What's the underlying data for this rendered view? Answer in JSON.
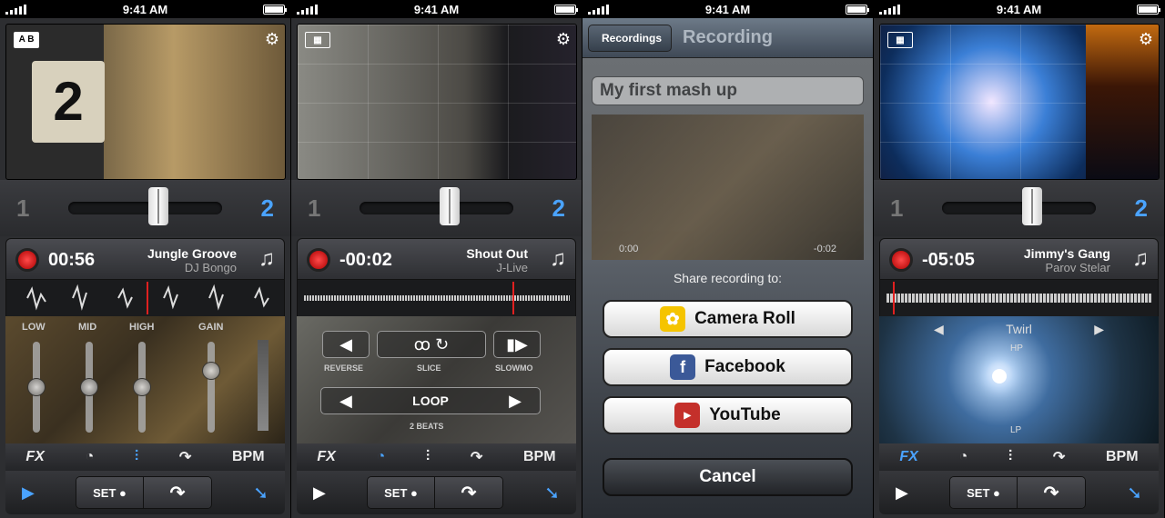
{
  "status": {
    "time": "9:41 AM"
  },
  "colors": {
    "accent": "#4aa3ff",
    "record": "#e02020"
  },
  "icons": [
    "gear-icon",
    "ab-icon",
    "grid-icon",
    "music-library-icon",
    "fx-icon",
    "loop-icon",
    "eq-icon",
    "redo-icon",
    "play-icon",
    "cue-icon"
  ],
  "panels": [
    {
      "deck": {
        "time": "00:56",
        "title": "Jungle Groove",
        "artist": "DJ Bongo"
      },
      "eq": {
        "low": "LOW",
        "mid": "MID",
        "high": "HIGH",
        "gain": "GAIN"
      }
    },
    {
      "deck": {
        "time": "-00:02",
        "title": "Shout Out",
        "artist": "J-Live"
      },
      "fx": {
        "reverse": "REVERSE",
        "slice": "SLICE",
        "slowmo": "SLOWMO",
        "loop": "LOOP",
        "beats": "2 BEATS"
      }
    },
    {
      "nav": {
        "back": "Recordings",
        "title": "Recording"
      },
      "name": "My first mash up",
      "player": {
        "elapsed": "0:00",
        "remaining": "-0:02"
      },
      "share": {
        "header": "Share recording to:",
        "camera_roll": "Camera Roll",
        "facebook": "Facebook",
        "youtube": "YouTube",
        "cancel": "Cancel"
      }
    },
    {
      "deck": {
        "time": "-05:05",
        "title": "Jimmy's Gang",
        "artist": "Parov Stelar"
      },
      "twirl": {
        "name": "Twirl",
        "hp": "HP",
        "lp": "LP"
      }
    }
  ],
  "common": {
    "deck_a": "1",
    "deck_b": "2",
    "fx": "FX",
    "bpm": "BPM",
    "set": "SET"
  }
}
